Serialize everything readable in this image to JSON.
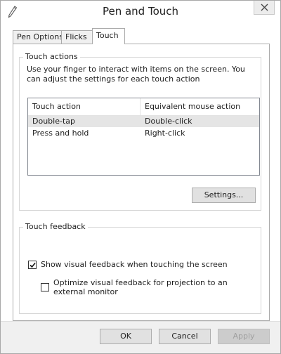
{
  "window": {
    "title": "Pen and Touch",
    "close_icon": "close-icon",
    "title_icon": "pen-icon"
  },
  "tabs": [
    {
      "label": "Pen Options",
      "active": false
    },
    {
      "label": "Flicks",
      "active": false
    },
    {
      "label": "Touch",
      "active": true
    }
  ],
  "touch_actions": {
    "legend": "Touch actions",
    "description": "Use your finger to interact with items on the screen. You can adjust the settings for each touch action",
    "columns": [
      "Touch action",
      "Equivalent mouse action"
    ],
    "rows": [
      {
        "action": "Double-tap",
        "mouse": "Double-click",
        "selected": true
      },
      {
        "action": "Press and hold",
        "mouse": "Right-click",
        "selected": false
      }
    ],
    "settings_button": "Settings..."
  },
  "touch_feedback": {
    "legend": "Touch feedback",
    "show_visual_feedback": {
      "label": "Show visual feedback when touching the screen",
      "checked": true
    },
    "optimize_projection": {
      "label": "Optimize visual feedback for projection to an external monitor",
      "checked": false
    }
  },
  "footer": {
    "ok": "OK",
    "cancel": "Cancel",
    "apply": "Apply",
    "apply_enabled": false
  }
}
